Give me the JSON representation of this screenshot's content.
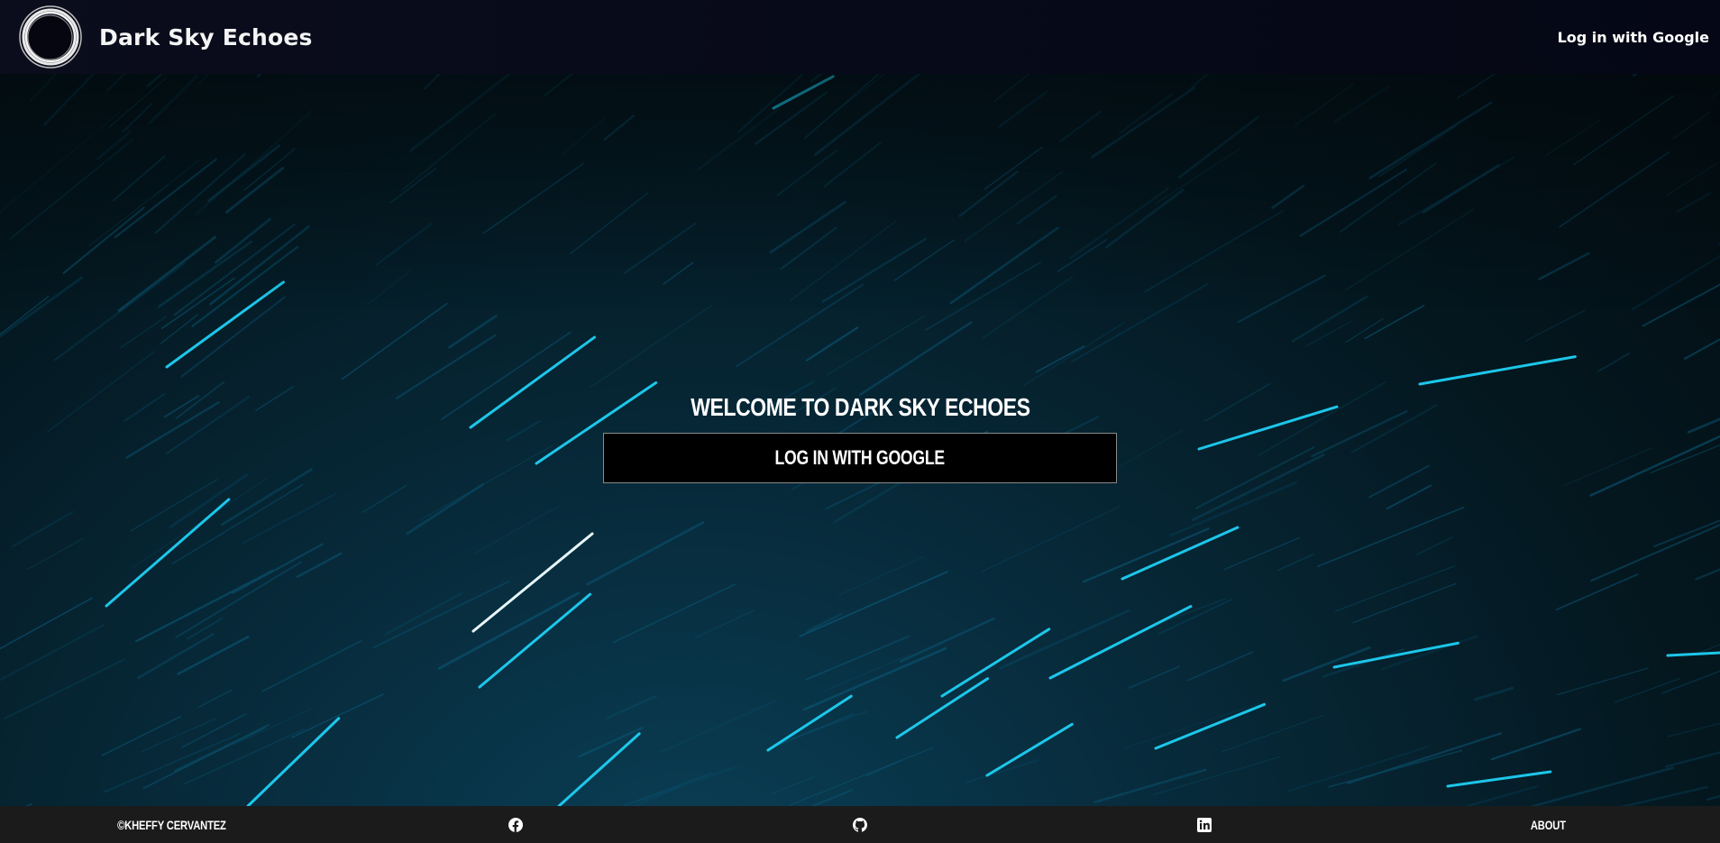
{
  "header": {
    "brand_title": "Dark Sky Echoes",
    "login_label": "Log in with Google",
    "logo_icon": "circle-logo-icon"
  },
  "hero": {
    "welcome": "Welcome to Dark Sky Echoes",
    "login_button": "Log in with Google",
    "background": "star-trails-night-sky"
  },
  "footer": {
    "copyright": "©Kheffy Cervantez",
    "icons": [
      "facebook-icon",
      "github-icon",
      "linkedin-icon"
    ],
    "about": "About"
  },
  "colors": {
    "header_bg": "#080b1b",
    "hero_bg": "#04171f",
    "trail": "#1fc8ef",
    "button_bg": "#000000",
    "footer_bg": "#1b1b1b"
  }
}
